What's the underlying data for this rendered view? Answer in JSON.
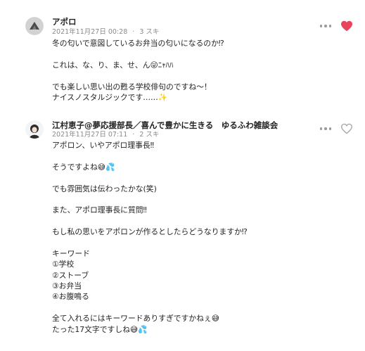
{
  "comments": [
    {
      "author": "アポロ",
      "date": "2021年11月27日 00:28",
      "likes": "3 スキ",
      "liked": true,
      "lines": [
        "冬の匂いで意図しているお弁当の匂いになるのか⁉",
        "",
        "これは、な、り、ま、せ、ん😜ﾆｬﾊﾊ",
        "",
        "でも楽しい思い出の甦る学校俳句のですね～！",
        "ナイスノスタルジックです……✨"
      ]
    },
    {
      "author": "江村恵子@夢応援部長／喜んで豊かに生きる　ゆるふわ雑談会",
      "date": "2021年11月27日 07:11",
      "likes": "2 スキ",
      "liked": false,
      "lines": [
        "アポロン、いやアポロ理事長‼",
        "",
        "そうですよね😅💦",
        "",
        "でも雰囲気は伝わったかな(笑)",
        "",
        "また、アポロ理事長に質問‼",
        "",
        "もし私の思いをアポロンが作るとしたらどうなりますか⁉",
        "",
        "キーワード",
        "①学校",
        "②ストーブ",
        "③お弁当",
        "④お腹鳴る",
        "",
        "全て入れるにはキーワードありすぎですかねぇ😅",
        "たった17文字ですしね😅💦"
      ]
    }
  ],
  "meta_separator": "·",
  "colors": {
    "liked_heart": "#e8445e",
    "unliked_heart": "#aaaaaa",
    "meta_text": "#8a8a8a"
  },
  "icons": {
    "more": "more-dots-icon",
    "like": "heart-icon"
  }
}
